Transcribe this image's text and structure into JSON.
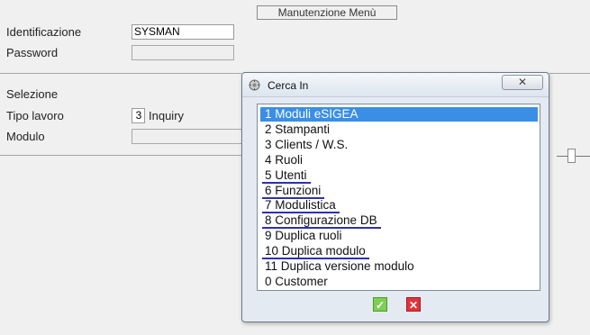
{
  "window": {
    "title": "Manutenzione Menù"
  },
  "form": {
    "identificazione": {
      "label": "Identificazione",
      "value": "SYSMAN"
    },
    "password": {
      "label": "Password",
      "value": ""
    },
    "selezione": {
      "label": "Selezione"
    },
    "tipo_lavoro": {
      "label": "Tipo lavoro",
      "code": "3",
      "description": "Inquiry"
    },
    "modulo": {
      "label": "Modulo",
      "value": ""
    }
  },
  "dialog": {
    "title": "Cerca In",
    "close_glyph": "✕",
    "items": [
      {
        "label": "1 Moduli eSIGEA",
        "selected": true,
        "underlined": false
      },
      {
        "label": "2 Stampanti",
        "selected": false,
        "underlined": false
      },
      {
        "label": "3 Clients / W.S.",
        "selected": false,
        "underlined": false
      },
      {
        "label": "4 Ruoli",
        "selected": false,
        "underlined": false
      },
      {
        "label": "5 Utenti",
        "selected": false,
        "underlined": true
      },
      {
        "label": "6 Funzioni",
        "selected": false,
        "underlined": true
      },
      {
        "label": "7 Modulistica",
        "selected": false,
        "underlined": true
      },
      {
        "label": "8 Configurazione DB",
        "selected": false,
        "underlined": true
      },
      {
        "label": "9 Duplica ruoli",
        "selected": false,
        "underlined": false
      },
      {
        "label": "10 Duplica modulo",
        "selected": false,
        "underlined": true
      },
      {
        "label": "11 Duplica versione modulo",
        "selected": false,
        "underlined": false
      },
      {
        "label": "0 Customer",
        "selected": false,
        "underlined": false
      }
    ],
    "ok_icon": "check-icon",
    "cancel_icon": "x-icon"
  },
  "colors": {
    "selection": "#3a8ee6",
    "underline": "#2f2fb0",
    "ok": "#7fcf54",
    "cancel": "#e0333a"
  }
}
